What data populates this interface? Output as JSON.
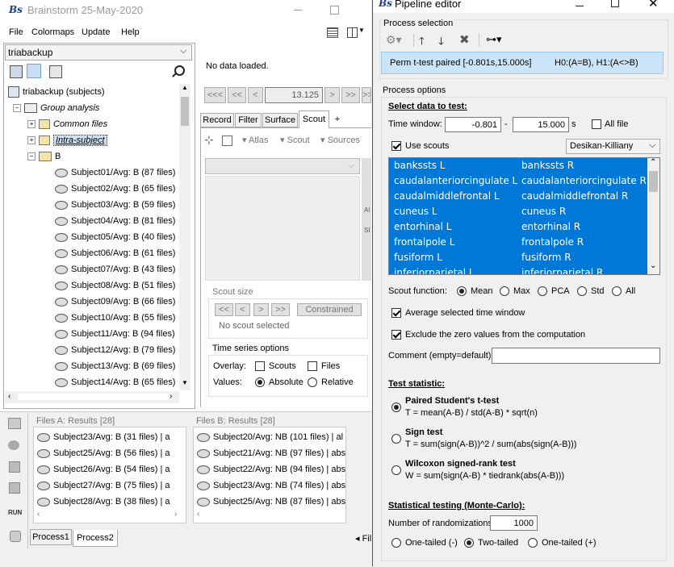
{
  "main_window": {
    "logo": "Bs",
    "title": "Brainstorm 25-May-2020",
    "menu": [
      "File",
      "Colormaps",
      "Update",
      "Help"
    ],
    "protocol": "triabackup",
    "tree": {
      "root": "triabackup (subjects)",
      "group": "Group analysis",
      "common": "Common files",
      "intra": "Intra-subject",
      "folder": "B",
      "subjects": [
        "Subject01/Avg: B (87 files)",
        "Subject02/Avg: B (65 files)",
        "Subject03/Avg: B (59 files)",
        "Subject04/Avg: B (81 files)",
        "Subject05/Avg: B (40 files)",
        "Subject06/Avg: B (61 files)",
        "Subject07/Avg: B (43 files)",
        "Subject08/Avg: B (51 files)",
        "Subject09/Avg: B (66 files)",
        "Subject10/Avg: B (55 files)",
        "Subject11/Avg: B (94 files)",
        "Subject12/Avg: B (79 files)",
        "Subject13/Avg: B (69 files)",
        "Subject14/Avg: B (65 files)"
      ]
    },
    "no_data": "No data loaded.",
    "time_nav": {
      "first": "<<<",
      "prev_fast": "<<",
      "prev": "<",
      "value": "13.125",
      "next": ">",
      "next_fast": ">>",
      "last": ">>>"
    },
    "tabs": [
      "Record",
      "Filter",
      "Surface",
      "Scout",
      "+"
    ],
    "active_tab": "Scout",
    "scout_toolbar": {
      "atlas": "Atlas",
      "scout": "Scout",
      "sources": "Sources"
    },
    "right_strip": [
      "Al",
      "SI"
    ],
    "scout_size": {
      "title": "Scout size",
      "buttons": [
        "<<",
        "<",
        ">",
        ">>"
      ],
      "constrained": "Constrained",
      "none": "No scout selected"
    },
    "ts_options": {
      "title": "Time series options",
      "overlay_label": "Overlay:",
      "scouts": "Scouts",
      "files": "Files",
      "values_label": "Values:",
      "absolute": "Absolute",
      "relative": "Relative"
    },
    "files_a": {
      "header": "Files A: Results [28]",
      "items": [
        "Subject23/Avg: B (31 files) | a",
        "Subject25/Avg: B (56 files) | a",
        "Subject26/Avg: B (54 files) | a",
        "Subject27/Avg: B (75 files) | a",
        "Subject28/Avg: B (38 files) | a"
      ]
    },
    "files_b": {
      "header": "Files B: Results [28]",
      "items": [
        "Subject20/Avg: NB (101 files) | al",
        "Subject21/Avg: NB (97 files) | abs",
        "Subject22/Avg: NB (94 files) | abs",
        "Subject23/Avg: NB (74 files) | abs",
        "Subject25/Avg: NB (87 files) | abs"
      ]
    },
    "run": "RUN",
    "process_tabs": [
      "Process1",
      "Process2"
    ],
    "filter_stub": "Fil"
  },
  "pipeline": {
    "logo": "Bs",
    "title": "Pipeline editor",
    "process_selection": "Process selection",
    "selected_process": "Perm t-test paired [-0.801s,15.000s]",
    "selected_hyp": "H0:(A=B), H1:(A<>B)",
    "process_options": "Process options",
    "select_data": "Select data to test:",
    "time_window_label": "Time window:",
    "tw_start": "-0.801",
    "tw_dash": "-",
    "tw_end": "15.000",
    "tw_unit": "s",
    "all_file": "All file",
    "use_scouts": "Use scouts",
    "atlas": "Desikan-Killiany",
    "scouts": [
      [
        "bankssts L",
        "bankssts R"
      ],
      [
        "caudalanteriorcingulate L",
        "caudalanteriorcingulate R"
      ],
      [
        "caudalmiddlefrontal L",
        "caudalmiddlefrontal R"
      ],
      [
        "cuneus L",
        "cuneus R"
      ],
      [
        "entorhinal L",
        "entorhinal R"
      ],
      [
        "frontalpole L",
        "frontalpole R"
      ],
      [
        "fusiform L",
        "fusiform R"
      ],
      [
        "inferiorparietal L",
        "inferiorparietal R"
      ]
    ],
    "scout_function_label": "Scout function:",
    "scout_functions": [
      "Mean",
      "Max",
      "PCA",
      "Std",
      "All"
    ],
    "avg_time": "Average selected time window",
    "exclude_zero": "Exclude the zero values from the computation",
    "comment_label": "Comment (empty=default):",
    "comment_value": "",
    "test_statistic": "Test statistic:",
    "tests": [
      {
        "name": "Paired Student's t-test",
        "formula": "T = mean(A-B) / std(A-B) * sqrt(n)"
      },
      {
        "name": "Sign test",
        "formula": "T = sum(sign(A-B))^2 / sum(abs(sign(A-B)))"
      },
      {
        "name": "Wilcoxon signed-rank test",
        "formula": "W = sum(sign(A-B) * tiedrank(abs(A-B)))"
      }
    ],
    "stat_testing": "Statistical testing (Monte-Carlo):",
    "nrand_label": "Number of randomizations:",
    "nrand": "1000",
    "tails": [
      "One-tailed (-)",
      "Two-tailed",
      "One-tailed (+)"
    ]
  },
  "colors": {
    "selection_blue": "#0078d7",
    "process_row": "#cce4f7",
    "accent_border": "#0066cc"
  }
}
